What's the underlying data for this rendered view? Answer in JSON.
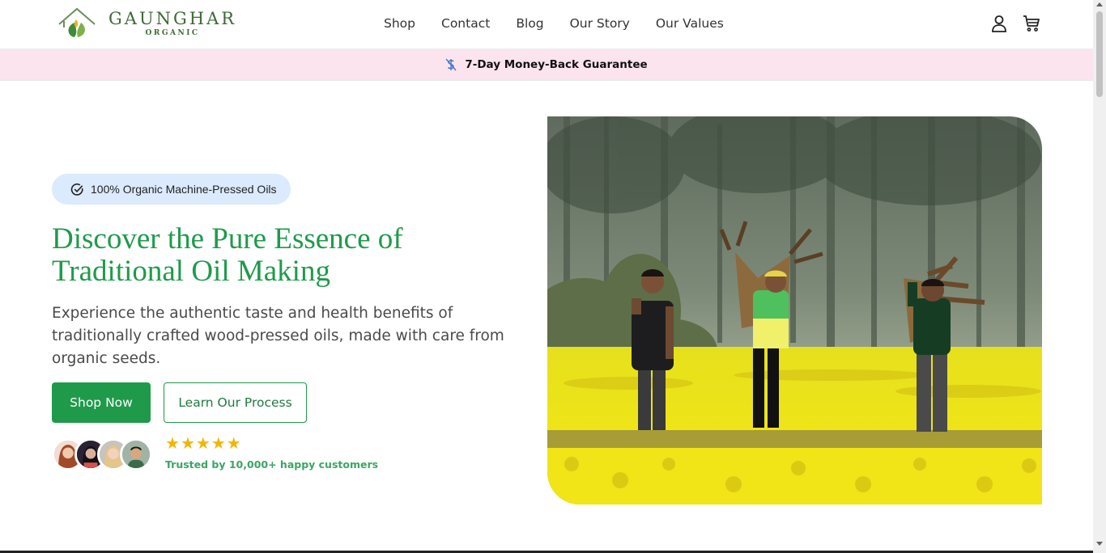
{
  "brand": {
    "name": "GAUNGHAR",
    "sub": "ORGANIC"
  },
  "nav": {
    "items": [
      {
        "label": "Shop"
      },
      {
        "label": "Contact"
      },
      {
        "label": "Blog"
      },
      {
        "label": "Our Story"
      },
      {
        "label": "Our Values"
      }
    ]
  },
  "header_icons": [
    "user-icon",
    "cart-icon"
  ],
  "banner": {
    "icon": "dollar-slash-icon",
    "text": "7-Day Money-Back Guarantee"
  },
  "hero": {
    "badge": "100% Organic Machine-Pressed Oils",
    "badge_icon": "check-circle-icon",
    "title": "Discover the Pure Essence of Traditional Oil Making",
    "description": "Experience the authentic taste and health benefits of traditionally crafted wood-pressed oils, made with care from organic seeds.",
    "primary_button": "Shop Now",
    "secondary_button": "Learn Our Process",
    "rating_stars": 5,
    "trusted_text": "Trusted by 10,000+ happy customers",
    "avatar_count": 4
  },
  "colors": {
    "brand_green": "#1f9a4b",
    "banner_pink": "#fbe4ee",
    "badge_blue": "#dbeafc",
    "star_gold": "#f2b600",
    "mustard_yellow": "#f3e61a"
  }
}
